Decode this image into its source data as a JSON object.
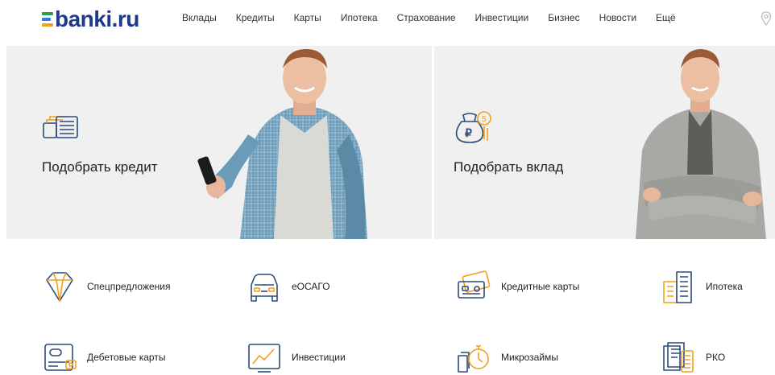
{
  "header": {
    "logo": "banki.ru",
    "nav": [
      "Вклады",
      "Кредиты",
      "Карты",
      "Ипотека",
      "Страхование",
      "Инвестиции",
      "Бизнес",
      "Новости",
      "Ещё"
    ]
  },
  "hero": {
    "left_title": "Подобрать кредит",
    "right_title": "Подобрать вклад"
  },
  "products": [
    {
      "label": "Спецпредложения",
      "icon": "diamond-icon"
    },
    {
      "label": "еОСАГО",
      "icon": "car-icon"
    },
    {
      "label": "Кредитные карты",
      "icon": "credit-card-icon"
    },
    {
      "label": "Ипотека",
      "icon": "building-icon"
    },
    {
      "label": "Дебетовые карты",
      "icon": "wallet-icon"
    },
    {
      "label": "Инвестиции",
      "icon": "chart-icon"
    },
    {
      "label": "Микрозаймы",
      "icon": "stopwatch-money-icon"
    },
    {
      "label": "РКО",
      "icon": "documents-icon"
    }
  ],
  "colors": {
    "accent_orange": "#f0a11a",
    "icon_blue": "#2b4a7a",
    "logo_blue": "#1e3a8a",
    "logo_green": "#2ea043"
  }
}
